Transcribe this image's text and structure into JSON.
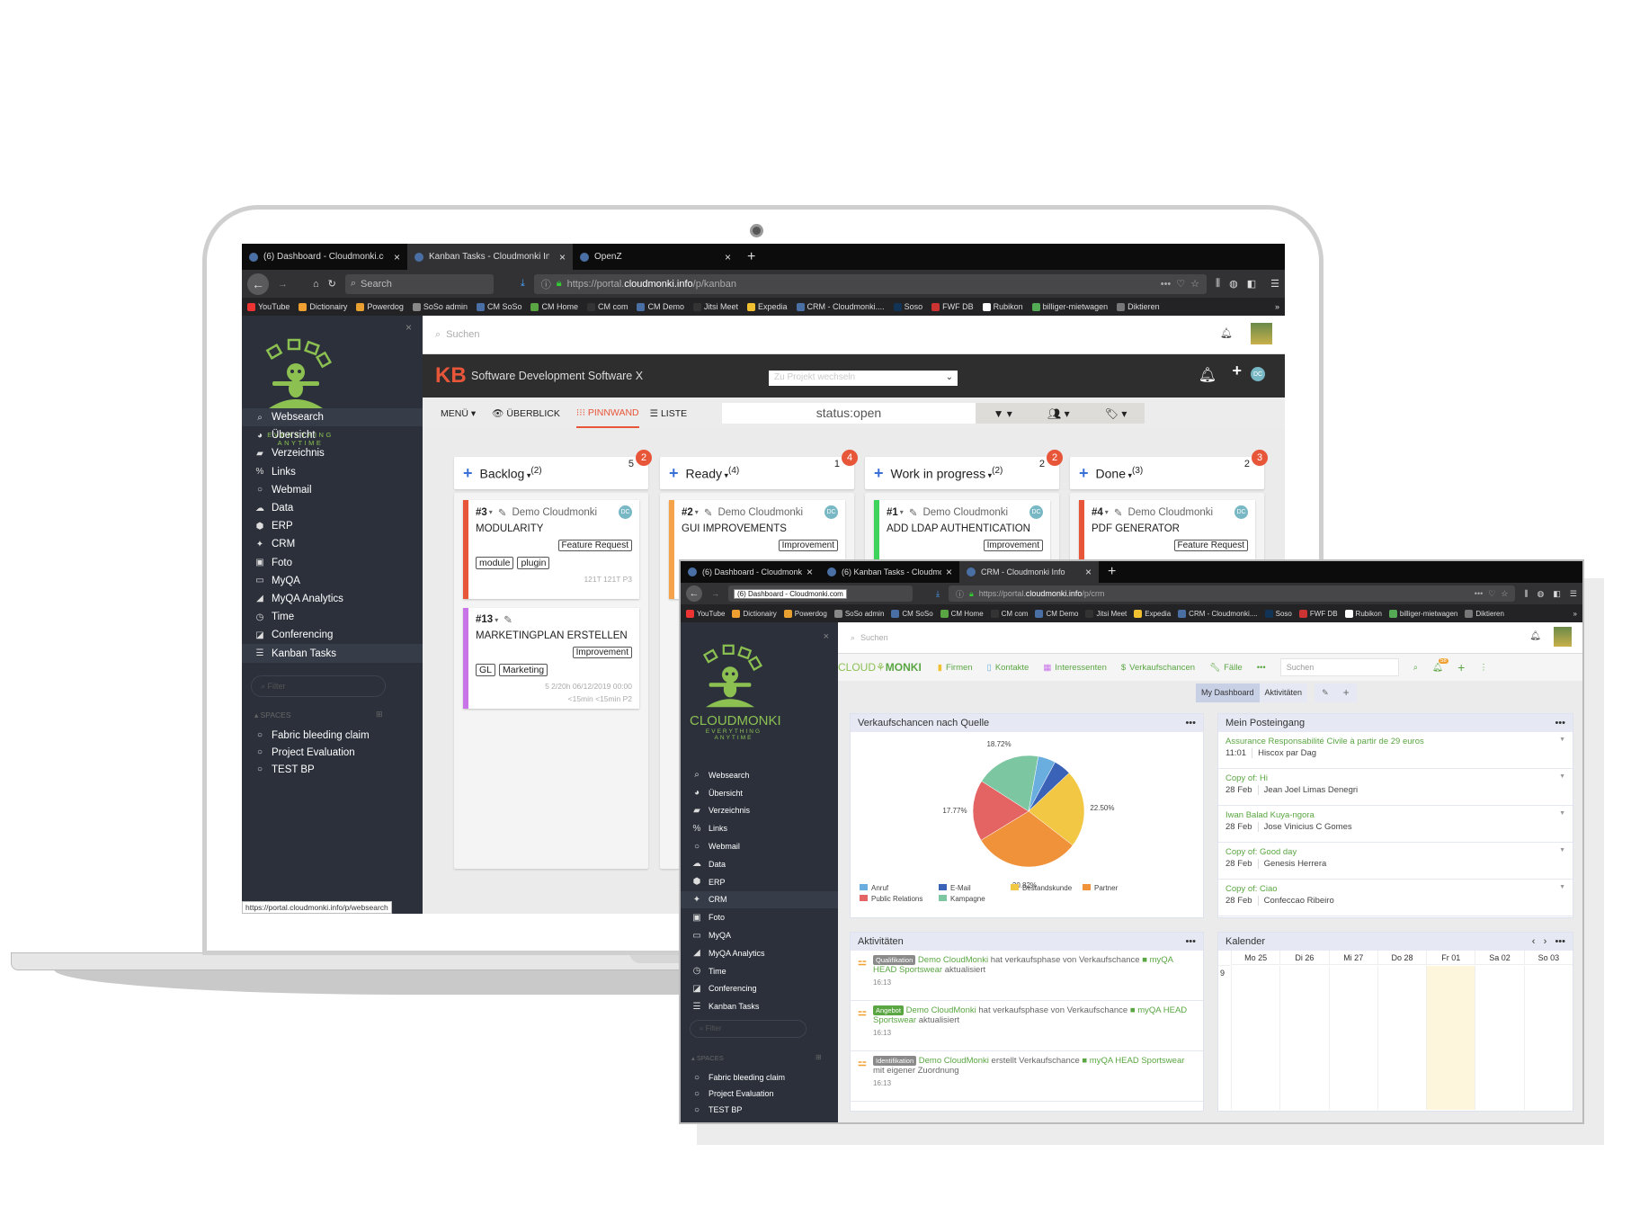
{
  "screen1": {
    "tabs": [
      {
        "label": "(6) Dashboard - Cloudmonki.co",
        "active": false
      },
      {
        "label": "Kanban Tasks - Cloudmonki Info",
        "active": true
      },
      {
        "label": "OpenZ",
        "active": false
      }
    ],
    "search_placeholder": "Search",
    "url_prefix": "https://portal.",
    "url_domain": "cloudmonki.info",
    "url_path": "/p/kanban",
    "app_search_placeholder": "Suchen",
    "kb_logo": "KB",
    "project_title": "Software Development Software X",
    "project_switch_placeholder": "Zu Projekt wechseln",
    "avatar_initials": "DC",
    "nav": {
      "menu": "MENÜ",
      "overview": "ÜBERBLICK",
      "board": "PINNWAND",
      "list": "LISTE"
    },
    "filter_value": "status:open",
    "status_url": "https://portal.cloudmonki.info/p/websearch",
    "columns": [
      {
        "title": "Backlog",
        "count": "(2)",
        "limit": "5",
        "badge": "2",
        "color": "#e8563a",
        "cards": [
          {
            "id": "#3",
            "owner": "Demo Cloudmonki",
            "title": "MODULARITY",
            "category": "Feature Request",
            "tags": [
              "module",
              "plugin"
            ],
            "footer": "121T 121T P3",
            "color": "#e8563a"
          },
          {
            "id": "#13",
            "owner": "",
            "title": "MARKETINGPLAN ERSTELLEN",
            "category": "Improvement",
            "tags": [
              "GL",
              "Marketing"
            ],
            "footer": "5  2/20h  06/12/2019 00:00",
            "footer2": "<15min <15min P2",
            "color": "#c973e8"
          }
        ]
      },
      {
        "title": "Ready",
        "count": "(4)",
        "limit": "1",
        "badge": "4",
        "color": "#f5a34a",
        "cards": [
          {
            "id": "#2",
            "owner": "Demo Cloudmonki",
            "title": "GUI IMPROVEMENTS",
            "category": "Improvement",
            "color": "#f5a34a"
          }
        ]
      },
      {
        "title": "Work in progress",
        "count": "(2)",
        "limit": "2",
        "badge": "2",
        "color": "#3ed35a",
        "cards": [
          {
            "id": "#1",
            "owner": "Demo Cloudmonki",
            "title": "ADD LDAP AUTHENTICATION",
            "category": "Improvement",
            "color": "#3ed35a"
          }
        ]
      },
      {
        "title": "Done",
        "count": "(3)",
        "limit": "2",
        "badge": "3",
        "color": "#e8563a",
        "cards": [
          {
            "id": "#4",
            "owner": "Demo Cloudmonki",
            "title": "PDF GENERATOR",
            "category": "Feature Request",
            "color": "#e8563a"
          }
        ]
      }
    ]
  },
  "bookmarks": [
    "YouTube",
    "Dictionairy",
    "Powerdog",
    "SoSo admin",
    "CM SoSo",
    "CM Home",
    "CM com",
    "CM Demo",
    "Jitsi Meet",
    "Expedia",
    "CRM - Cloudmonki....",
    "Soso",
    "FWF DB",
    "Rubikon",
    "billiger-mietwagen",
    "Diktieren"
  ],
  "sidebar": {
    "logo_text": "CLOUDMONKI",
    "logo_tagline": "EVERYTHING ANYTIME",
    "items": [
      {
        "label": "Websearch",
        "icon": "search-icon",
        "glyph": "⌕"
      },
      {
        "label": "Übersicht",
        "icon": "dashboard-icon",
        "glyph": "◕"
      },
      {
        "label": "Verzeichnis",
        "icon": "book-icon",
        "glyph": "▰"
      },
      {
        "label": "Links",
        "icon": "link-icon",
        "glyph": "%"
      },
      {
        "label": "Webmail",
        "icon": "circle-icon",
        "glyph": "○"
      },
      {
        "label": "Data",
        "icon": "cloud-icon",
        "glyph": "☁"
      },
      {
        "label": "ERP",
        "icon": "cube-icon",
        "glyph": "⬢"
      },
      {
        "label": "CRM",
        "icon": "users-icon",
        "glyph": "✦"
      },
      {
        "label": "Foto",
        "icon": "image-icon",
        "glyph": "▣"
      },
      {
        "label": "MyQA",
        "icon": "monitor-icon",
        "glyph": "▭"
      },
      {
        "label": "MyQA Analytics",
        "icon": "area-chart-icon",
        "glyph": "◢"
      },
      {
        "label": "Time",
        "icon": "clock-icon",
        "glyph": "◷"
      },
      {
        "label": "Conferencing",
        "icon": "share-icon",
        "glyph": "◪"
      },
      {
        "label": "Kanban Tasks",
        "icon": "kanban-icon",
        "glyph": "☰"
      }
    ],
    "filter_placeholder": "Filter",
    "spaces_label": "SPACES",
    "spaces": [
      "Fabric bleeding claim",
      "Project Evaluation",
      "TEST BP"
    ]
  },
  "screen2": {
    "tabs": [
      {
        "label": "(6) Dashboard - Cloudmonki.co",
        "active": false
      },
      {
        "label": "(6) Kanban Tasks - Cloudmonki",
        "active": false
      },
      {
        "label": "CRM - Cloudmonki Info",
        "active": true
      }
    ],
    "tooltip": "(6) Dashboard - Cloudmonki.com",
    "url_prefix": "https://portal.",
    "url_domain": "cloudmonki.info",
    "url_path": "/p/crm",
    "app_search_placeholder": "Suchen",
    "crm_logo_left": "CLOUD",
    "crm_logo_right": "MONKI",
    "crm_nav": [
      "Firmen",
      "Kontakte",
      "Interessenten",
      "Verkaufschancen",
      "Fälle"
    ],
    "crm_search_placeholder": "Suchen",
    "notif_count": "58",
    "dash_tabs": [
      "My Dashboard",
      "Aktivitäten"
    ],
    "pie_panel_title": "Verkaufschancen nach Quelle",
    "inbox_title": "Mein Posteingang",
    "inbox": [
      {
        "subject": "Assurance Responsabilité Civile à partir de 29 euros",
        "date": "11:01",
        "from": "Hiscox par Dag"
      },
      {
        "subject": "Copy of: Hi",
        "date": "28 Feb",
        "from": "Jean Joel Limas Denegri"
      },
      {
        "subject": "Iwan Balad Kuya-ngora",
        "date": "28 Feb",
        "from": "Jose Vinicius C Gomes"
      },
      {
        "subject": "Copy of: Good day",
        "date": "28 Feb",
        "from": "Genesis Herrera"
      },
      {
        "subject": "Copy of: Ciao",
        "date": "28 Feb",
        "from": "Confeccao Ribeiro"
      }
    ],
    "activities_title": "Aktivitäten",
    "activities": [
      {
        "stage": "Qualifikation",
        "stage_color": "#8a8a8a",
        "actor": "Demo CloudMonki",
        "verb": " hat verkaufsphase von Verkaufschance ",
        "target": "■ myQA HEAD Sportswear",
        "rest": " aktualisiert",
        "time": "16:13"
      },
      {
        "stage": "Angebot",
        "stage_color": "#5aa642",
        "actor": "Demo CloudMonki",
        "verb": " hat verkaufsphase von Verkaufschance ",
        "target": "■ myQA HEAD Sportswear",
        "rest": " aktualisiert",
        "time": "16:13"
      },
      {
        "stage": "Identifikation",
        "stage_color": "#8a8a8a",
        "actor": "Demo CloudMonki",
        "verb": " erstellt Verkaufschance ",
        "target": "■ myQA HEAD Sportswear",
        "rest": " mit eigener Zuordnung",
        "time": "16:13"
      }
    ],
    "calendar_title": "Kalender",
    "calendar_days": [
      "Mo 25",
      "Di 26",
      "Mi 27",
      "Do 28",
      "Fr 01",
      "Sa 02",
      "So 03"
    ],
    "calendar_today_index": 4,
    "calendar_hour": "9"
  },
  "chart_data": {
    "type": "pie",
    "title": "Verkaufschancen nach Quelle",
    "legend_position": "bottom",
    "categories": [
      "Anruf",
      "E-Mail",
      "Bestandskunde",
      "Partner",
      "Public Relations",
      "Kampagne"
    ],
    "values": [
      5.1,
      5.09,
      22.5,
      30.82,
      17.77,
      18.72
    ],
    "labels": [
      "",
      "",
      "22.50%",
      "30.82%",
      "17.77%",
      "18.72%"
    ],
    "colors": [
      "#6aaee0",
      "#3a63b8",
      "#f2c744",
      "#f0923a",
      "#e46464",
      "#7cc7a2"
    ]
  }
}
